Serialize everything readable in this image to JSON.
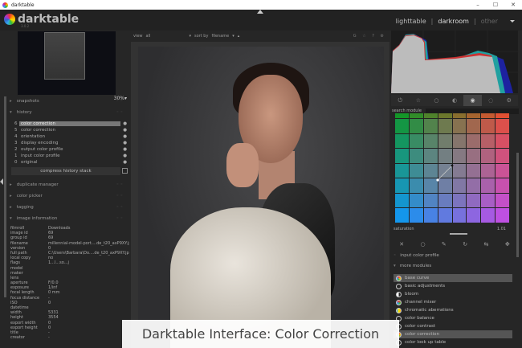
{
  "window": {
    "title": "darktable",
    "controls": [
      "–",
      "☐",
      "✕"
    ]
  },
  "logo": {
    "name": "darktable",
    "version": "3.0.2"
  },
  "views": {
    "items": [
      "lighttable",
      "darkroom",
      "other"
    ],
    "active": "darkroom",
    "separator": "|"
  },
  "navigation": {
    "zoom": "30%▾"
  },
  "left_panel": {
    "sections": {
      "snapshots": "snapshots",
      "history": "history",
      "duplicate_manager": "duplicate manager",
      "color_picker": "color picker",
      "tagging": "tagging",
      "image_information": "image information"
    },
    "history_items": [
      {
        "n": "6",
        "label": "color correction"
      },
      {
        "n": "5",
        "label": "color correction"
      },
      {
        "n": "4",
        "label": "orientation"
      },
      {
        "n": "3",
        "label": "display encoding"
      },
      {
        "n": "2",
        "label": "output color profile"
      },
      {
        "n": "1",
        "label": "input color profile"
      },
      {
        "n": "0",
        "label": "original"
      }
    ],
    "compress_label": "compress history stack",
    "image_info": [
      [
        "filmroll",
        "Downloads"
      ],
      [
        "image id",
        "69"
      ],
      [
        "group id",
        "69"
      ],
      [
        "filename",
        "millennial-model-port....de_t20_axP9XY.jpg"
      ],
      [
        "version",
        "0"
      ],
      [
        "full path",
        "C:\\Users\\Barbara\\Do....de_t20_axP9XY.jpg"
      ],
      [
        "local copy",
        "no"
      ],
      [
        "flags",
        "1...l...so...j"
      ],
      [
        "model",
        ""
      ],
      [
        "maker",
        ""
      ],
      [
        "lens",
        ""
      ],
      [
        "aperture",
        "F/0.0"
      ],
      [
        "exposure",
        "1/inf"
      ],
      [
        "focal length",
        "0 mm"
      ],
      [
        "focus distance",
        "-"
      ],
      [
        "ISO",
        "0"
      ],
      [
        "datetime",
        ""
      ],
      [
        "width",
        "5331"
      ],
      [
        "height",
        "3554"
      ],
      [
        "export width",
        "0"
      ],
      [
        "export height",
        "0"
      ],
      [
        "title",
        "-"
      ],
      [
        "creator",
        "-"
      ]
    ]
  },
  "filterbar": {
    "view_label": "view",
    "view_value": "all",
    "sort_label": "sort by",
    "sort_value": "filename",
    "icons": "G ☆ ? ⚙"
  },
  "right_panel": {
    "module_tabs": [
      "⏻",
      "☆",
      "○",
      "◐",
      "◉",
      "◌",
      "⚙"
    ],
    "active_tab": 4,
    "search_label": "search module",
    "saturation_label": "saturation",
    "saturation_value": "1.01",
    "tool_icons": [
      "✕",
      "○",
      "✎",
      "↻",
      "⇆",
      "✥"
    ],
    "input_color_profile": "input color profile",
    "more_modules": "more modules",
    "modules": [
      {
        "label": "base curve",
        "selected": true
      },
      {
        "label": "basic adjustments",
        "selected": false
      },
      {
        "label": "bloom",
        "selected": false
      },
      {
        "label": "channel mixer",
        "selected": false
      },
      {
        "label": "chromatic aberrations",
        "selected": false
      },
      {
        "label": "color balance",
        "selected": false
      },
      {
        "label": "color contrast",
        "selected": false
      },
      {
        "label": "color correction",
        "selected": true
      },
      {
        "label": "color look up table",
        "selected": false
      }
    ]
  },
  "caption": "Darktable Interface: Color Correction"
}
